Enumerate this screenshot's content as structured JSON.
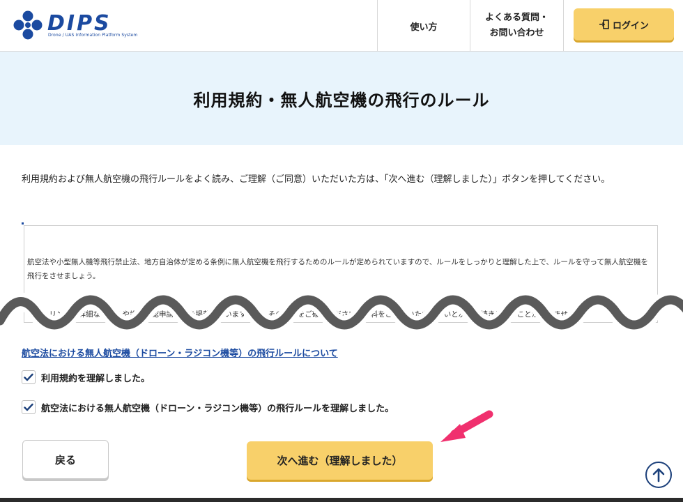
{
  "header": {
    "logo_text": "DIPS",
    "logo_subtitle": "Drone / UAS Information Platform System",
    "nav": {
      "howto": "使い方",
      "faq_line1": "よくある質問・",
      "faq_line2": "お問い合わせ",
      "login": "ログイン"
    }
  },
  "page_title": "利用規約・無人航空機の飛行のルール",
  "intro": "利用規約および無人航空機の飛行ルールをよく読み、ご理解（ご同意）いただいた方は、「次へ進む（理解しました）」ボタンを押してください。",
  "terms": {
    "paragraph1": "航空法や小型無人機等飛行禁止法、地方自治体が定める条例に無人航空機を飛行するためのルールが定められていますので、ルールをしっかりと理解した上で、ルールを守って無人航空機を飛行をさせましょう。",
    "paragraph2": "以下のリンクに詳細なルールや許可承認申請方法を掲載していますので、その内容をご確認ください。資料をご確認いただかないと次の手続きに進むことができません。"
  },
  "rules_link": "航空法における無人航空機（ドローン・ラジコン機等）の飛行ルールについて",
  "checks": [
    {
      "label": "利用規約を理解しました。",
      "checked": true
    },
    {
      "label": "航空法における無人航空機（ドローン・ラジコン機等）の飛行ルールを理解しました。",
      "checked": true
    }
  ],
  "buttons": {
    "back": "戻る",
    "next": "次へ進む（理解しました）"
  },
  "icons": {
    "login": "login-door-icon",
    "check": "checkmark-icon",
    "scroll_top": "arrow-up-circle-icon",
    "annotation": "pink-arrow-icon"
  },
  "colors": {
    "brand_blue": "#1b4aa0",
    "accent_yellow": "#f8d06a",
    "title_band": "#e8f4fc",
    "annotation_pink": "#f0306e"
  }
}
